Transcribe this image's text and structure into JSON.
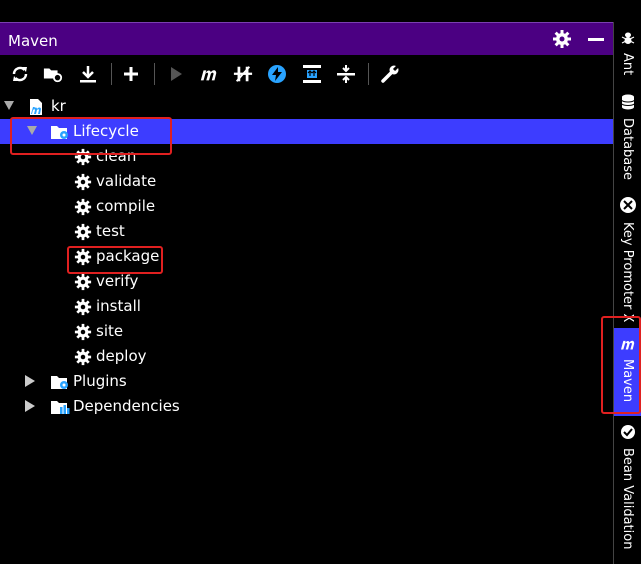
{
  "window": {
    "title": "Maven"
  },
  "toolbar": {
    "buttons": [
      "reload-all-icon",
      "import-icon",
      "download-icon",
      "add-icon",
      "run-icon",
      "maven-goal-icon",
      "skip-tests-icon",
      "offline-icon",
      "show-dependencies-icon",
      "collapse-all-icon",
      "settings-icon"
    ]
  },
  "tree": {
    "root": {
      "label": "kr"
    },
    "lifecycle": {
      "label": "Lifecycle"
    },
    "phases": [
      "clean",
      "validate",
      "compile",
      "test",
      "package",
      "verify",
      "install",
      "site",
      "deploy"
    ],
    "plugins": {
      "label": "Plugins"
    },
    "dependencies": {
      "label": "Dependencies"
    }
  },
  "sidebar": {
    "tabs": [
      {
        "label": "Ant"
      },
      {
        "label": "Database"
      },
      {
        "label": "Key Promoter X"
      },
      {
        "label": "Maven"
      },
      {
        "label": "Bean Validation"
      }
    ]
  },
  "colors": {
    "title_bg": "#4b0082",
    "selection": "#3d3dff",
    "highlight_box": "#e02020",
    "accent_blue": "#29a3ff"
  }
}
